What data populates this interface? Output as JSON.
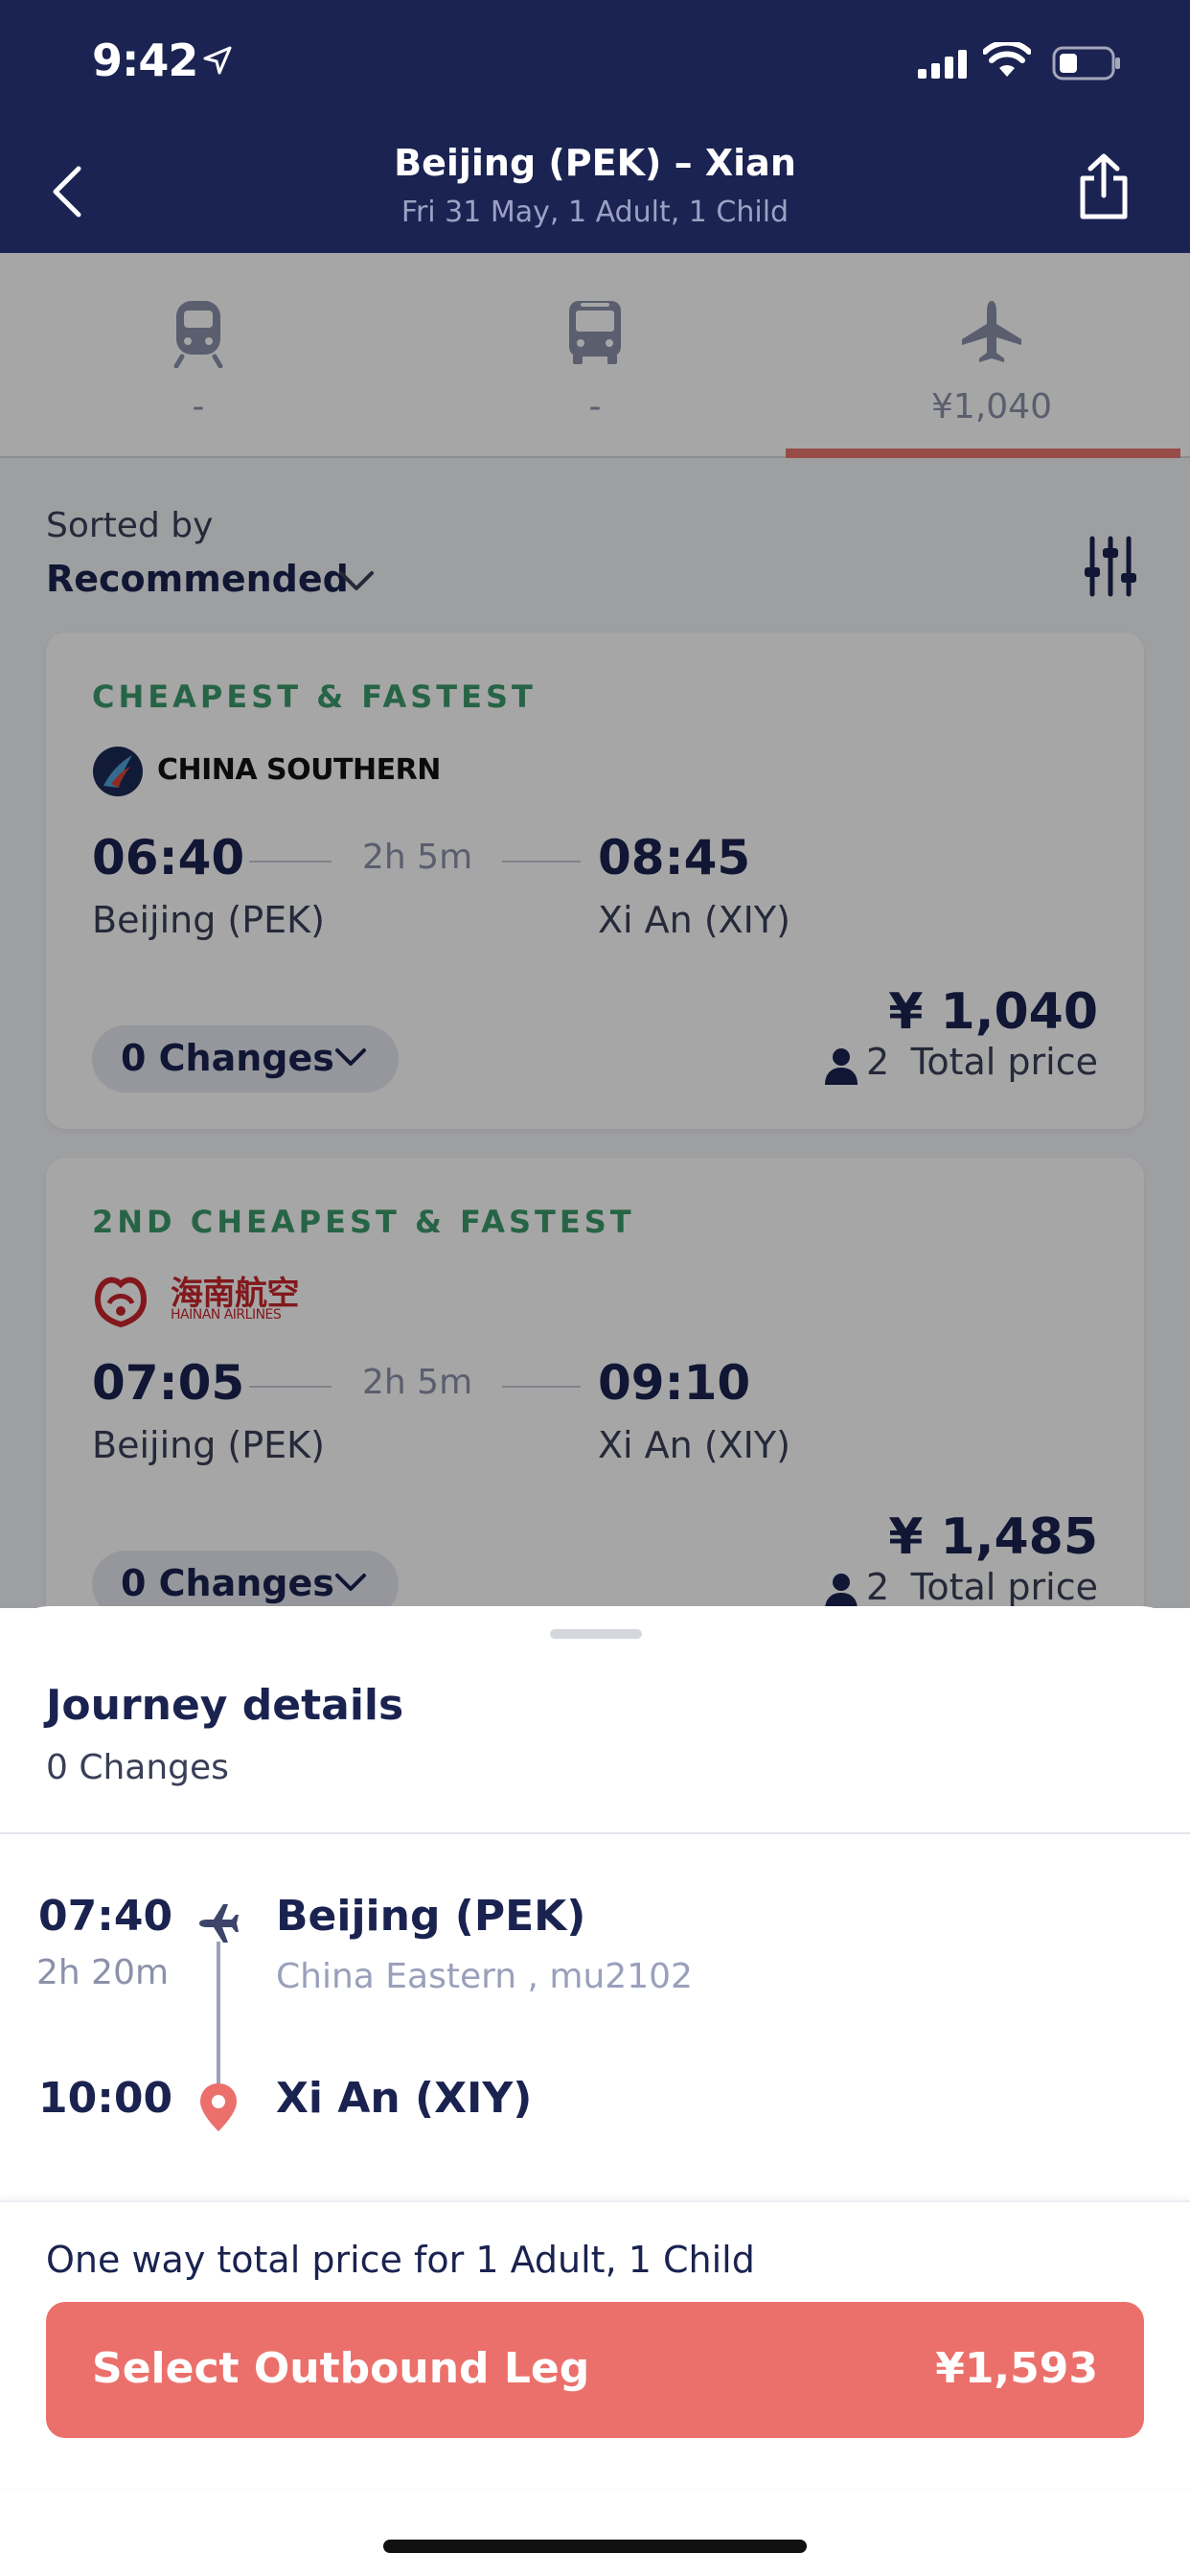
{
  "status_bar": {
    "time": "9:42"
  },
  "nav": {
    "title": "Beijing (PEK) – Xian",
    "subtitle": "Fri 31 May, 1 Adult, 1 Child"
  },
  "tabs": [
    {
      "icon": "train-icon",
      "label": "-"
    },
    {
      "icon": "bus-icon",
      "label": "-"
    },
    {
      "icon": "plane-icon",
      "label": "¥1,040",
      "active": true
    }
  ],
  "sort": {
    "label": "Sorted by",
    "value": "Recommended"
  },
  "results": [
    {
      "tag": "CHEAPEST & FASTEST",
      "airline": "CHINA SOUTHERN",
      "dep_time": "06:40",
      "duration": "2h 5m",
      "arr_time": "08:45",
      "dep_city": "Beijing (PEK)",
      "arr_city": "Xi An (XIY)",
      "price": "¥ 1,040",
      "pax": "2",
      "price_label": "Total price",
      "changes": "0 Changes"
    },
    {
      "tag": "2ND CHEAPEST & FASTEST",
      "airline": "海南航空",
      "airline_en": "HAINAN AIRLINES",
      "dep_time": "07:05",
      "duration": "2h 5m",
      "arr_time": "09:10",
      "dep_city": "Beijing (PEK)",
      "arr_city": "Xi An (XIY)",
      "price": "¥ 1,485",
      "pax": "2",
      "price_label": "Total price",
      "changes": "0 Changes"
    }
  ],
  "sheet": {
    "title": "Journey details",
    "subtitle": "0 Changes",
    "leg": {
      "dep_time": "07:40",
      "duration": "2h 20m",
      "dep_city": "Beijing (PEK)",
      "carrier": "China Eastern , mu2102",
      "arr_time": "10:00",
      "arr_city": "Xi An (XIY)"
    },
    "footer_note": "One way total price for 1 Adult, 1 Child",
    "cta_label": "Select Outbound Leg",
    "cta_price": "¥1,593"
  },
  "colors": {
    "header_bg": "#1b2352",
    "accent": "#eb706b",
    "tag_green": "#3c9a6c",
    "text_primary": "#1a2350"
  }
}
